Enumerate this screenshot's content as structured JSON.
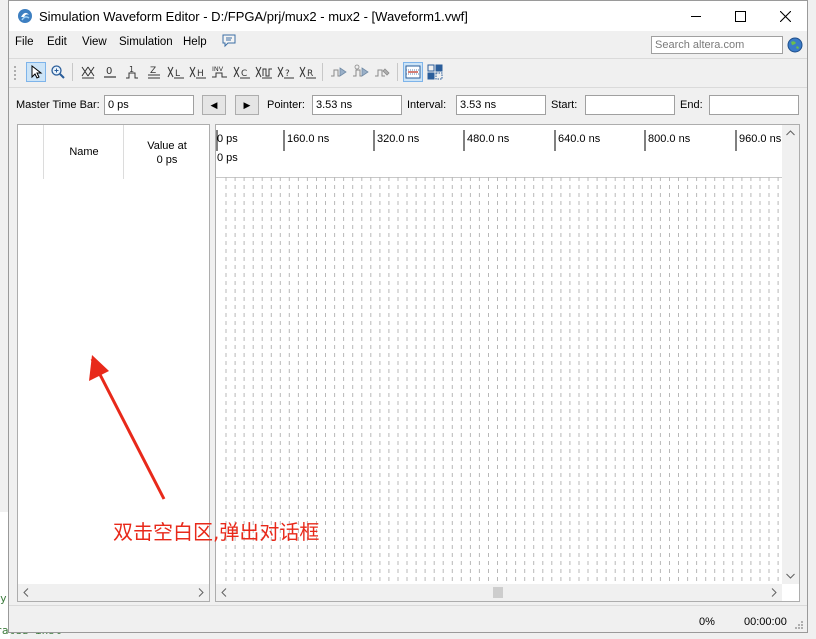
{
  "window": {
    "title": "Simulation Waveform Editor - D:/FPGA/prj/mux2 - mux2 - [Waveform1.vwf]",
    "minimize_glyph": "—",
    "maximize_glyph": "☐",
    "close_glyph": "✕"
  },
  "menu": [
    "File",
    "Edit",
    "View",
    "Simulation",
    "Help"
  ],
  "search": {
    "placeholder": "Search altera.com"
  },
  "toolbar_icons": [
    "selection-tool-icon",
    "zoom-tool-icon",
    "force-unknown-icon",
    "force-low-icon",
    "force-high-icon",
    "force-high-impedance-icon",
    "force-weak-low-icon",
    "force-weak-high-icon",
    "invert-icon",
    "count-value-icon",
    "overwrite-clock-icon",
    "random-values-icon",
    "overwrite-value-icon",
    "run-functional-simulation-icon",
    "run-timing-simulation-icon",
    "generate-netlist-icon",
    "snap-to-grid-icon",
    "group-icon"
  ],
  "controls": {
    "master_time_bar_label": "Master Time Bar:",
    "master_time_bar_value": "0 ps",
    "prev_glyph": "◀",
    "next_glyph": "▶",
    "pointer_label": "Pointer:",
    "pointer_value": "3.53 ns",
    "interval_label": "Interval:",
    "interval_value": "3.53 ns",
    "start_label": "Start:",
    "start_value": "",
    "end_label": "End:",
    "end_value": ""
  },
  "signal_table": {
    "name_header": "Name",
    "value_header_line1": "Value at",
    "value_header_line2": "0 ps"
  },
  "timeline": {
    "ticks": [
      "0 ps",
      "160.0 ns",
      "320.0 ns",
      "480.0 ns",
      "640.0 ns",
      "800.0 ns",
      "960.0 ns"
    ],
    "master_marker_label": "0 ps"
  },
  "status": {
    "progress": "0%",
    "elapsed": "00:00:00"
  },
  "annotation": {
    "text": "双击空白区,弹出对话框",
    "color": "#e8291a"
  },
  "background_app": {
    "partial_text": "nerated inst\"",
    "partial_mark": "y"
  }
}
